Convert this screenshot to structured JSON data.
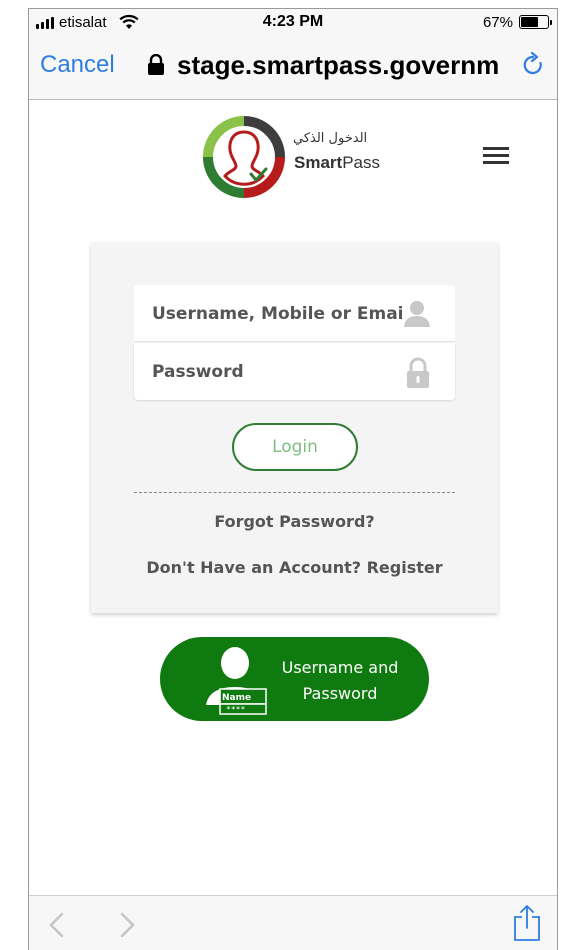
{
  "status_bar": {
    "carrier": "etisalat",
    "time": "4:23 PM",
    "battery_percent": "67%",
    "battery_level": 0.67,
    "icons": [
      "signal-icon",
      "wifi-icon",
      "battery-icon"
    ]
  },
  "browser": {
    "cancel_label": "Cancel",
    "url": "stage.smartpass.governme",
    "icons": [
      "lock-icon",
      "reload-icon"
    ]
  },
  "header": {
    "logo_arabic": "الدخول الذكي",
    "logo_english_bold": "Smart",
    "logo_english_regular": "Pass",
    "icons": [
      "smartpass-logo",
      "hamburger-menu-icon"
    ]
  },
  "login_form": {
    "username_placeholder": "Username, Mobile or Email",
    "password_placeholder": "Password",
    "login_label": "Login",
    "forgot_password": "Forgot Password?",
    "register_prompt": "Don't Have an Account? Register",
    "icons": [
      "user-icon",
      "padlock-icon"
    ]
  },
  "alt_login": {
    "line1": "Username and",
    "line2": "Password",
    "card_name": "Name",
    "card_mask": "****",
    "icons": [
      "id-card-user-icon"
    ]
  },
  "toolbar": {
    "icons": [
      "back-arrow-icon",
      "forward-arrow-icon",
      "share-icon"
    ]
  },
  "colors": {
    "link_blue": "#2f7de1",
    "brand_green": "#0f7a0f",
    "login_border": "#2e7d32",
    "login_text": "#7cbf80",
    "brand_red": "#b71c1c"
  }
}
